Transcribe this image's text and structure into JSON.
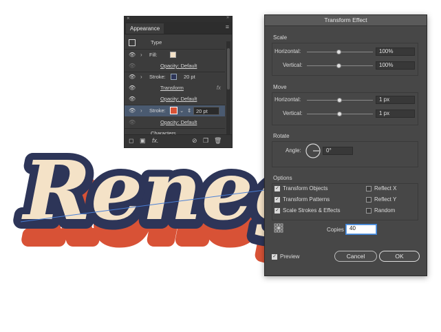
{
  "artwork": {
    "text": "Reneg",
    "colors": {
      "cream": "#f4e2c7",
      "navy": "#2d3558",
      "red": "#d85236"
    }
  },
  "appearance": {
    "tab": "Appearance",
    "close_glyph": "×",
    "collapse_glyph": "»",
    "menu_icon": "hamburger-icon",
    "rows": {
      "type": "Type",
      "fill": "Fill:",
      "fill_opacity": "Opacity: Default",
      "stroke1": "Stroke:",
      "stroke1_weight": "20 pt",
      "transform": "Transform",
      "transform_fx": "fx",
      "stroke1_opacity": "Opacity: Default",
      "stroke2": "Stroke:",
      "stroke2_weight": "20 pt",
      "stroke2_opacity": "Opacity: Default",
      "characters": "Characters"
    },
    "bottom_fx": "fx.",
    "colors": {
      "fill_swatch": "#f4e2c7",
      "stroke1_swatch": "#2d3558",
      "stroke2_swatch": "#d85236",
      "selected_row": "#4a5a70"
    }
  },
  "dialog": {
    "title": "Transform Effect",
    "scale": {
      "title": "Scale",
      "h_label": "Horizontal:",
      "h_value": "100%",
      "v_label": "Vertical:",
      "v_value": "100%"
    },
    "move": {
      "title": "Move",
      "h_label": "Horizontal:",
      "h_value": "1 px",
      "v_label": "Vertical:",
      "v_value": "1 px"
    },
    "rotate": {
      "title": "Rotate",
      "angle_label": "Angle:",
      "angle_value": "0°"
    },
    "options": {
      "title": "Options",
      "transform_objects": "Transform Objects",
      "transform_patterns": "Transform Patterns",
      "scale_strokes": "Scale Strokes & Effects",
      "reflect_x": "Reflect X",
      "reflect_y": "Reflect Y",
      "random": "Random",
      "checked": {
        "transform_objects": true,
        "transform_patterns": true,
        "scale_strokes": true,
        "reflect_x": false,
        "reflect_y": false,
        "random": false
      }
    },
    "copies_label": "Copies",
    "copies_value": "40",
    "preview_label": "Preview",
    "preview_checked": true,
    "cancel_label": "Cancel",
    "ok_label": "OK"
  }
}
